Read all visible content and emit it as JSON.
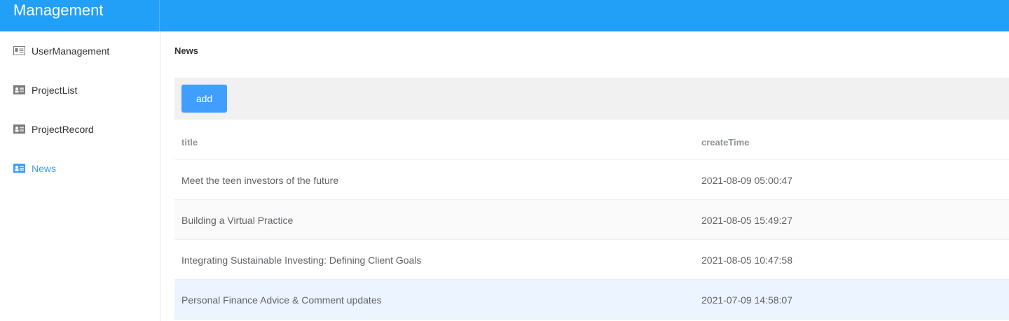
{
  "header": {
    "brand": "Management"
  },
  "sidebar": {
    "items": [
      {
        "label": "UserManagement",
        "icon": "id-card-icon",
        "active": false
      },
      {
        "label": "ProjectList",
        "icon": "id-card-icon",
        "active": false
      },
      {
        "label": "ProjectRecord",
        "icon": "id-card-icon",
        "active": false
      },
      {
        "label": "News",
        "icon": "id-card-icon",
        "active": true
      }
    ]
  },
  "main": {
    "title": "News",
    "toolbar": {
      "add_label": "add"
    },
    "table": {
      "columns": [
        "title",
        "createTime"
      ],
      "rows": [
        {
          "title": "Meet the teen investors of the future",
          "createTime": "2021-08-09 05:00:47"
        },
        {
          "title": "Building a Virtual Practice",
          "createTime": "2021-08-05 15:49:27"
        },
        {
          "title": "Integrating Sustainable Investing: Defining Client Goals",
          "createTime": "2021-08-05 10:47:58"
        },
        {
          "title": "Personal Finance Advice & Comment updates",
          "createTime": "2021-07-09 14:58:07"
        }
      ]
    }
  },
  "colors": {
    "header_bg": "#22a0f7",
    "accent": "#409eff",
    "icon_gray": "#7a7a7a"
  }
}
